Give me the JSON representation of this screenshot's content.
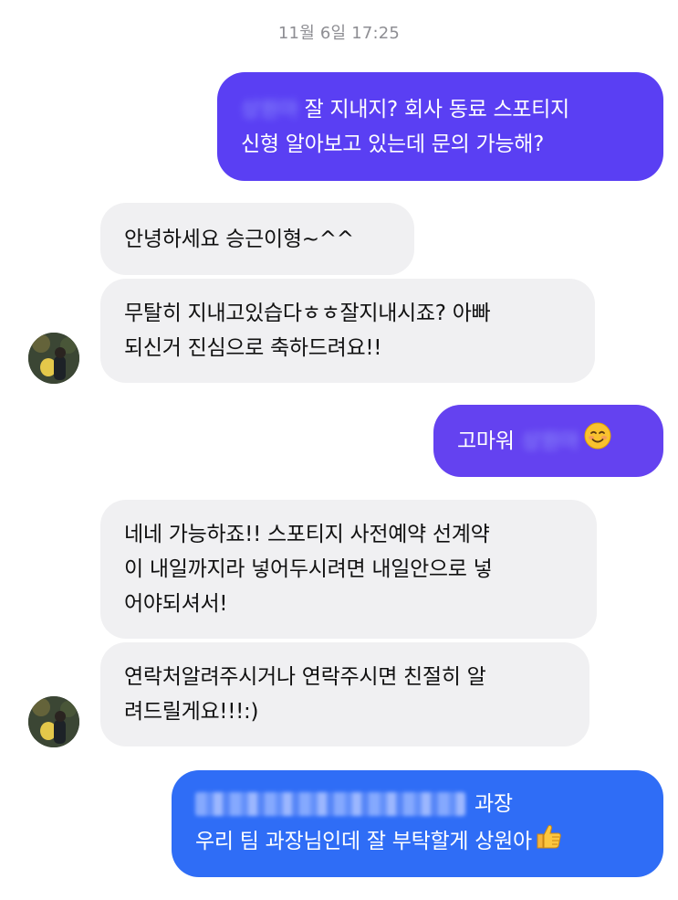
{
  "chat": {
    "timestamp": "11월 6일 17:25",
    "messages": [
      {
        "side": "sent",
        "blurred_prefix": "상원아",
        "lines": [
          "잘 지내지? 회사 동료 스포티지",
          "신형 알아보고 있는데 문의 가능해?"
        ]
      },
      {
        "side": "received",
        "lines": [
          "안녕하세요 승근이형~^^"
        ]
      },
      {
        "side": "received",
        "lines": [
          "무탈히 지내고있습다ㅎㅎ잘지내시죠? 아빠",
          "되신거 진심으로 축하드려요!!"
        ]
      },
      {
        "side": "sent",
        "text": "고마워",
        "blurred_suffix": "상원아",
        "emoji": "smiling-face-icon"
      },
      {
        "side": "received",
        "lines": [
          "네네 가능하죠!! 스포티지 사전예약 선계약",
          "이 내일까지라 넣어두시려면 내일안으로 넣",
          "어야되셔서!"
        ]
      },
      {
        "side": "received",
        "lines": [
          "연락처알려주시거나 연락주시면 친절히 알",
          "려드릴게요!!!:)"
        ]
      },
      {
        "side": "sent",
        "line1_suffix": "과장",
        "line2": "우리 팀 과장님인데 잘 부탁할게 상원아",
        "emoji": "thumbs-up-icon"
      }
    ]
  },
  "colors": {
    "sent_purple": "#5a3ff3",
    "sent_blue": "#2f6df6",
    "received_bg": "#f0f0f2",
    "timestamp": "#8e8e93"
  }
}
